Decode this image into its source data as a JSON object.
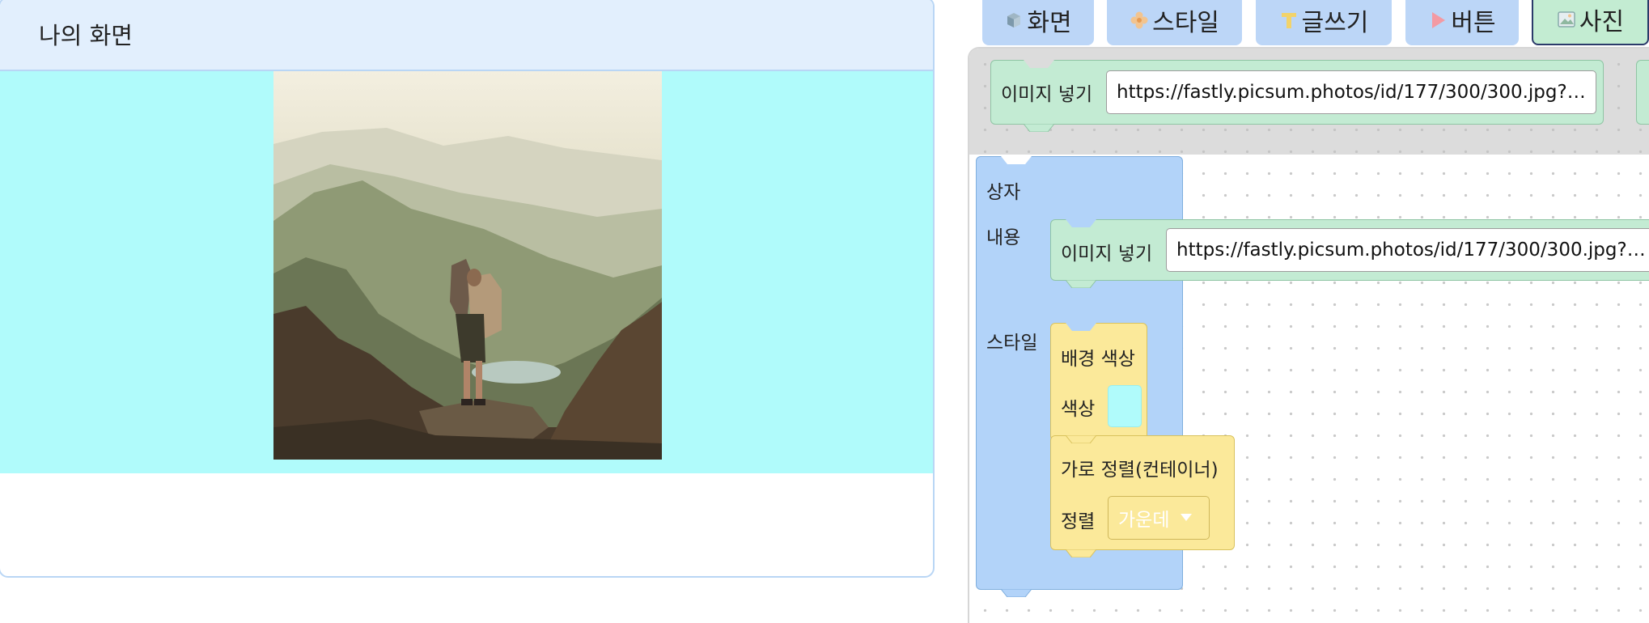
{
  "preview": {
    "title": "나의 화면",
    "box_background": "#b0fbfb",
    "image_alt": "hiker standing on a mountain ridge"
  },
  "tabs": [
    {
      "label": "화면",
      "icon": "cube-icon",
      "active": false
    },
    {
      "label": "스타일",
      "icon": "flower-icon",
      "active": false
    },
    {
      "label": "글쓰기",
      "icon": "text-t-icon",
      "active": false
    },
    {
      "label": "버튼",
      "icon": "play-triangle-icon",
      "active": false
    },
    {
      "label": "사진",
      "icon": "picture-icon",
      "active": true
    }
  ],
  "flyout": {
    "image_block": {
      "label": "이미지 넣기",
      "url": "https://fastly.picsum.photos/id/177/300/300.jpg?…"
    }
  },
  "workspace": {
    "container_block": {
      "title": "상자",
      "content_label": "내용",
      "style_label": "스타일",
      "image_block": {
        "label": "이미지 넣기",
        "url": "https://fastly.picsum.photos/id/177/300/300.jpg?…"
      },
      "bg_color_block": {
        "title": "배경 색상",
        "color_label": "색상",
        "color_value": "#b0fbfb"
      },
      "align_block": {
        "title": "가로 정렬(컨테이너)",
        "align_label": "정렬",
        "align_value": "가운데"
      }
    }
  }
}
